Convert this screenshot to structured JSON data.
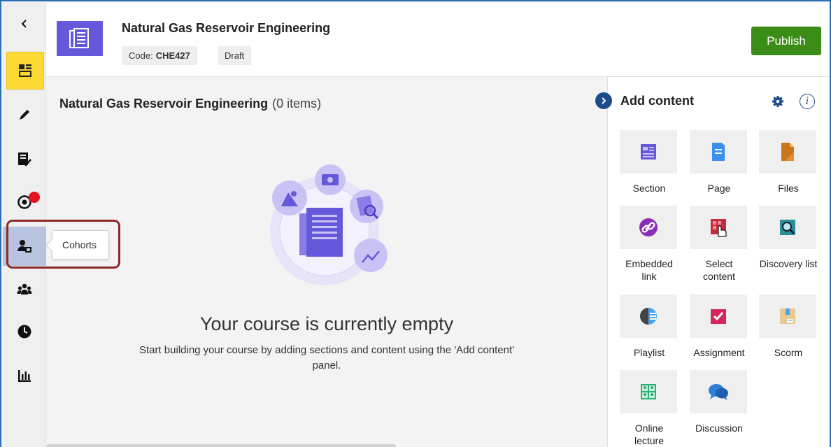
{
  "header": {
    "course_title": "Natural Gas Reservoir Engineering",
    "code_label": "Code:",
    "code_value": "CHE427",
    "status": "Draft",
    "publish_label": "Publish"
  },
  "rail": {
    "tooltip": "Cohorts",
    "items": [
      "back-icon",
      "course-outline-icon",
      "edit-icon",
      "grading-icon",
      "goals-icon",
      "cohorts-icon",
      "groups-icon",
      "clock-icon",
      "analytics-icon"
    ],
    "notification_color": "#e5131d"
  },
  "main": {
    "title": "Natural Gas Reservoir Engineering",
    "item_count": "(0 items)",
    "empty_title": "Your course is currently empty",
    "empty_subtitle": "Start building your course by adding sections and content using the 'Add content' panel."
  },
  "panel": {
    "title": "Add content",
    "tiles": [
      {
        "label": "Section",
        "icon": "section-icon"
      },
      {
        "label": "Page",
        "icon": "page-icon"
      },
      {
        "label": "Files",
        "icon": "files-icon"
      },
      {
        "label": "Embedded link",
        "icon": "embedded-link-icon"
      },
      {
        "label": "Select content",
        "icon": "select-content-icon"
      },
      {
        "label": "Discovery list",
        "icon": "discovery-list-icon"
      },
      {
        "label": "Playlist",
        "icon": "playlist-icon"
      },
      {
        "label": "Assignment",
        "icon": "assignment-icon"
      },
      {
        "label": "Scorm",
        "icon": "scorm-icon"
      },
      {
        "label": "Online lecture",
        "icon": "online-lecture-icon"
      },
      {
        "label": "Discussion",
        "icon": "discussion-icon"
      }
    ]
  },
  "colors": {
    "accent": "#6658db",
    "publish": "#3b8d17",
    "active_rail": "#fbd832",
    "highlight": "#8b2a2a",
    "nav_blue": "#1d4b8c"
  }
}
